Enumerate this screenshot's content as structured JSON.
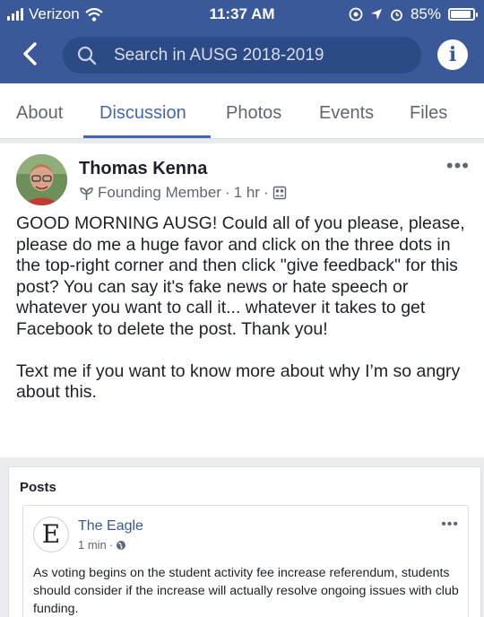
{
  "status_bar": {
    "carrier": "Verizon",
    "time": "11:37 AM",
    "battery": "85%"
  },
  "header": {
    "search_placeholder": "Search in AUSG 2018-2019",
    "info_label": "i"
  },
  "tabs": [
    {
      "label": "About",
      "active": false
    },
    {
      "label": "Discussion",
      "active": true
    },
    {
      "label": "Photos",
      "active": false
    },
    {
      "label": "Events",
      "active": false
    },
    {
      "label": "Files",
      "active": false
    }
  ],
  "post": {
    "author": "Thomas Kenna",
    "badge": "Founding Member",
    "time": "1 hr",
    "paragraphs": [
      "GOOD MORNING AUSG! Could all of you please, please, please do me a huge favor and click on the three dots in the top-right corner and then click \"give feedback\" for this post? You can say it's fake news or hate speech or whatever you want to call it... whatever it takes to get Facebook to delete the post. Thank you!",
      "Text me if you want to know more about why I’m so angry about this."
    ]
  },
  "shared": {
    "section_title": "Posts",
    "page_name": "The Eagle",
    "logo_letter": "E",
    "time": "1 min",
    "text": "As voting begins on the student activity fee increase referendum, students should consider if the increase will actually resolve ongoing issues with club funding."
  },
  "colors": {
    "header_blue": "#3b5998",
    "accent_blue": "#4267b2",
    "link_blue": "#385898"
  },
  "icons": [
    "signal-icon",
    "wifi-icon",
    "at-icon",
    "location-icon",
    "alarm-icon",
    "battery-icon",
    "back-icon",
    "search-icon",
    "info-icon",
    "founding-member-icon",
    "group-icon",
    "globe-icon",
    "more-icon"
  ]
}
